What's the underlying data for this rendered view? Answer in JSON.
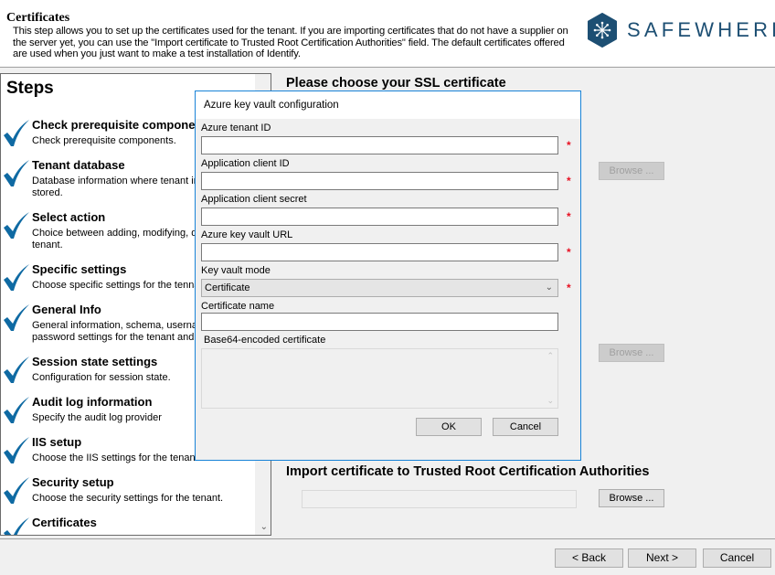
{
  "header": {
    "title": "Certificates",
    "description": "This step allows you to set up the certificates used for the tenant. If you are importing certificates that do not have a supplier on the server yet, you can use the \"Import certificate to Trusted Root Certification Authorities\" field. The default certificates offered are used when you just want to make a test installation of Identify.",
    "logo_text": "SAFEWHERE",
    "brand_color": "#1d4f73"
  },
  "steps": {
    "title": "Steps",
    "check_color": "#0f6aa3",
    "items": [
      {
        "name": "Check prerequisite components",
        "desc": "Check prerequisite components.",
        "done": true
      },
      {
        "name": "Tenant database",
        "desc": "Database information where tenant information is stored.",
        "done": true
      },
      {
        "name": "Select action",
        "desc": "Choice between adding, modifying, deleting a tenant.",
        "done": true
      },
      {
        "name": "Specific settings",
        "desc": "Choose specific settings for the tennant.",
        "done": true
      },
      {
        "name": "General Info",
        "desc": "General information, schema, username and password settings for the tenant and database.",
        "done": true
      },
      {
        "name": "Session state settings",
        "desc": "Configuration for session state.",
        "done": true
      },
      {
        "name": "Audit log information",
        "desc": "Specify the audit log provider",
        "done": true
      },
      {
        "name": "IIS setup",
        "desc": "Choose the IIS settings for the tenant.",
        "done": true
      },
      {
        "name": "Security setup",
        "desc": "Choose the security settings for the tenant.",
        "done": true
      },
      {
        "name": "Certificates",
        "desc": "",
        "done": true
      }
    ]
  },
  "main": {
    "ssl_title": "Please choose your SSL certificate",
    "browse_label": "Browse ...",
    "import_title": "Import certificate to Trusted Root Certification Authorities",
    "import_path": ""
  },
  "dialog": {
    "title": "Azure key vault configuration",
    "fields": {
      "tenant_id": {
        "label": "Azure tenant ID",
        "value": "",
        "required": true
      },
      "client_id": {
        "label": "Application client ID",
        "value": "",
        "required": true
      },
      "client_secret": {
        "label": "Application client secret",
        "value": "",
        "required": true
      },
      "vault_url": {
        "label": "Azure key vault URL",
        "value": "",
        "required": true
      },
      "vault_mode": {
        "label": "Key vault mode",
        "value": "Certificate",
        "required": true
      },
      "cert_name": {
        "label": "Certificate name",
        "value": "",
        "required": false
      },
      "base64_cert": {
        "label": "Base64-encoded certificate",
        "value": ""
      }
    },
    "required_marker": "*",
    "ok_label": "OK",
    "cancel_label": "Cancel"
  },
  "footer": {
    "back_label": "< Back",
    "next_label": "Next >",
    "cancel_label": "Cancel"
  }
}
